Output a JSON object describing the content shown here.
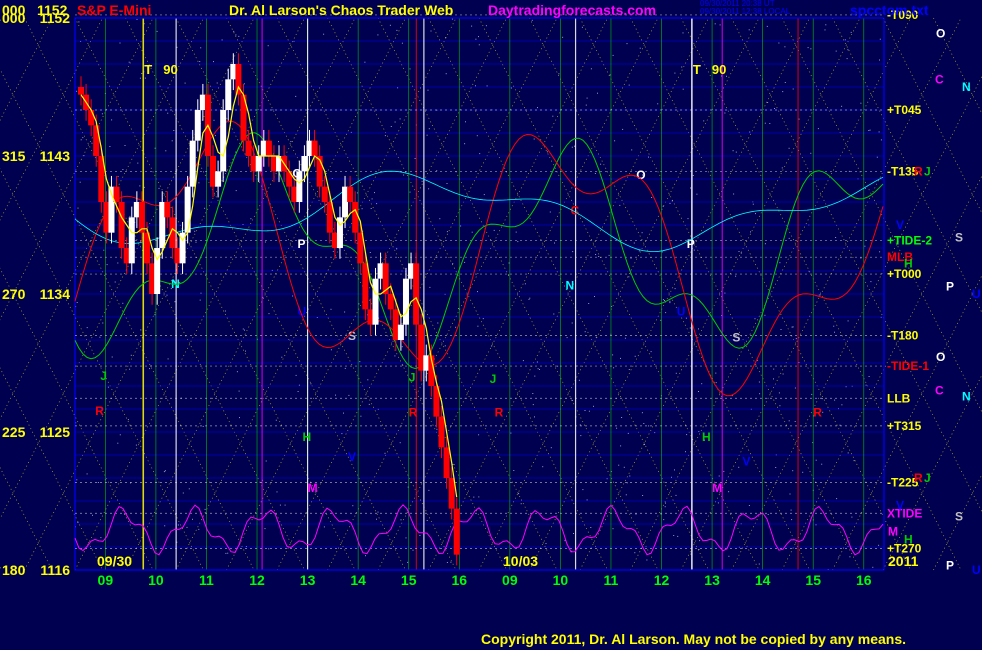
{
  "header": {
    "left_code": "000",
    "left_price": "1152",
    "symbol": "S&P E-Mini",
    "title": "Dr. Al Larson's Chaos Trader Web",
    "site": "Daytradingforecasts.com",
    "stamp_1": "09/30/2011 20:38 UT",
    "stamp_2": "09/30/2011 12:38 LOCAL",
    "file": "spcctom.txt"
  },
  "copyright": "Copyright 2011, Dr. Al Larson. May not be copied by any means.",
  "colors": {
    "background": "#000050",
    "grid": "#0000ff",
    "yellow_line": "#ffff00",
    "green_line": "#00cc00",
    "red_line": "#ff0000",
    "magenta_line": "#ff00ff",
    "cyan_line": "#00ffff",
    "up_bar": "#ffffff",
    "down_bar": "#ff0000"
  },
  "chart_data": {
    "type": "candlestick",
    "title": "S&P E-Mini",
    "y_range": [
      1116,
      1152
    ],
    "y_ticks": [
      {
        "code": "000",
        "price": "1152",
        "value": 1152
      },
      {
        "code": "315",
        "price": "1143",
        "value": 1143
      },
      {
        "code": "270",
        "price": "1134",
        "value": 1134
      },
      {
        "code": "225",
        "price": "1125",
        "value": 1125
      },
      {
        "code": "180",
        "price": "1116",
        "value": 1116
      }
    ],
    "x_ticks": [
      "09",
      "10",
      "11",
      "12",
      "13",
      "14",
      "15",
      "16",
      "09",
      "10",
      "11",
      "12",
      "13",
      "14",
      "15",
      "16"
    ],
    "date_labels": [
      "09/30",
      "10/03"
    ],
    "year_label": "2011",
    "time_markers": [
      {
        "label": "T",
        "value": "90"
      },
      {
        "label": "T",
        "value": "90"
      }
    ],
    "price_closes": [
      1147,
      1146,
      1145,
      1143,
      1140,
      1138,
      1141,
      1140,
      1137,
      1136,
      1139,
      1140,
      1138,
      1136,
      1134,
      1137,
      1140,
      1139,
      1137,
      1136,
      1138,
      1141,
      1144,
      1146,
      1147,
      1143,
      1141,
      1142,
      1146,
      1148,
      1149,
      1147,
      1144,
      1143,
      1142,
      1143,
      1144,
      1143,
      1142,
      1143,
      1142,
      1141,
      1140,
      1142,
      1143,
      1144,
      1143,
      1141,
      1140,
      1138,
      1137,
      1139,
      1141,
      1140,
      1138,
      1136,
      1133,
      1132,
      1135,
      1136,
      1134,
      1133,
      1131,
      1132,
      1135,
      1136,
      1132,
      1129,
      1130,
      1128,
      1126,
      1124,
      1122,
      1120,
      1117
    ],
    "levels": [
      {
        "label": "-T090",
        "price": 1152.2
      },
      {
        "label": "+T045",
        "price": 1146.0
      },
      {
        "label": "-T135",
        "price": 1142.0
      },
      {
        "label": "+TIDE-2",
        "price": 1137.5
      },
      {
        "label": "MLB",
        "price": 1136.4
      },
      {
        "label": "+T000",
        "price": 1135.3
      },
      {
        "label": "-T180",
        "price": 1131.3
      },
      {
        "label": "-TIDE-1",
        "price": 1129.3
      },
      {
        "label": "LLB",
        "price": 1127.2
      },
      {
        "label": "+T315",
        "price": 1125.4
      },
      {
        "label": "-T225",
        "price": 1121.7
      },
      {
        "label": "XTIDE",
        "price": 1119.7
      },
      {
        "label": "+T270",
        "price": 1117.4
      }
    ],
    "side_glyphs": [
      {
        "text": "O",
        "color": "#ffffff",
        "price": 1151
      },
      {
        "text": "C",
        "color": "#ff00ff",
        "price": 1148
      },
      {
        "text": "N",
        "color": "#00ffff",
        "price": 1147.5
      },
      {
        "text": "R",
        "color": "#ff0000",
        "price": 1142
      },
      {
        "text": "J",
        "color": "#00cc00",
        "price": 1142
      },
      {
        "text": "V",
        "color": "#0000ff",
        "price": 1138.5
      },
      {
        "text": "S",
        "color": "#c0c0c0",
        "price": 1137.7
      },
      {
        "text": "H",
        "color": "#00cc00",
        "price": 1136
      },
      {
        "text": "P",
        "color": "#ffffff",
        "price": 1134.5
      },
      {
        "text": "U",
        "color": "#0000ff",
        "price": 1134
      },
      {
        "text": "O",
        "color": "#ffffff",
        "price": 1129.9
      },
      {
        "text": "C",
        "color": "#ff00ff",
        "price": 1127.7
      },
      {
        "text": "N",
        "color": "#00ffff",
        "price": 1127.3
      },
      {
        "text": "R",
        "color": "#ff0000",
        "price": 1122.0
      },
      {
        "text": "J",
        "color": "#00cc00",
        "price": 1122.0
      },
      {
        "text": "V",
        "color": "#0000ff",
        "price": 1120.2
      },
      {
        "text": "S",
        "color": "#c0c0c0",
        "price": 1119.5
      },
      {
        "text": "M",
        "color": "#ff00ff",
        "price": 1118.5
      },
      {
        "text": "H",
        "color": "#00cc00",
        "price": 1118.0
      },
      {
        "text": "P",
        "color": "#ffffff",
        "price": 1116.3
      },
      {
        "text": "U",
        "color": "#0000ff",
        "price": 1116.0
      }
    ],
    "plot_glyphs": [
      {
        "text": "O",
        "color": "#ffffff",
        "day": 1,
        "hour": 12.7,
        "price": 1141.6
      },
      {
        "text": "N",
        "color": "#00ffff",
        "day": 1,
        "hour": 10.3,
        "price": 1134.4
      },
      {
        "text": "P",
        "color": "#ffffff",
        "day": 1,
        "hour": 12.8,
        "price": 1137.0
      },
      {
        "text": "U",
        "color": "#0000ff",
        "day": 1,
        "hour": 12.8,
        "price": 1132.6
      },
      {
        "text": "S",
        "color": "#c0c0c0",
        "day": 1,
        "hour": 13.8,
        "price": 1131.0
      },
      {
        "text": "J",
        "color": "#00cc00",
        "day": 1,
        "hour": 8.9,
        "price": 1128.4
      },
      {
        "text": "R",
        "color": "#ff0000",
        "day": 1,
        "hour": 8.8,
        "price": 1126.1
      },
      {
        "text": "H",
        "color": "#00cc00",
        "day": 1,
        "hour": 12.9,
        "price": 1124.4
      },
      {
        "text": "V",
        "color": "#0000ff",
        "day": 1,
        "hour": 13.8,
        "price": 1123.1
      },
      {
        "text": "M",
        "color": "#ff00ff",
        "day": 1,
        "hour": 13.0,
        "price": 1121.1
      },
      {
        "text": "R",
        "color": "#ff0000",
        "day": 1,
        "hour": 15.0,
        "price": 1126.0
      },
      {
        "text": "J",
        "color": "#00cc00",
        "day": 1,
        "hour": 15.0,
        "price": 1128.3
      },
      {
        "text": "R",
        "color": "#ff0000",
        "day": 2,
        "hour": 8.7,
        "price": 1126.0
      },
      {
        "text": "J",
        "color": "#00cc00",
        "day": 2,
        "hour": 8.6,
        "price": 1128.2
      },
      {
        "text": "N",
        "color": "#00ffff",
        "day": 2,
        "hour": 10.1,
        "price": 1134.3
      },
      {
        "text": "C",
        "color": "#ff0000",
        "day": 2,
        "hour": 10.2,
        "price": 1139.2
      },
      {
        "text": "O",
        "color": "#ffffff",
        "day": 2,
        "hour": 11.5,
        "price": 1141.5
      },
      {
        "text": "P",
        "color": "#ffffff",
        "day": 2,
        "hour": 12.5,
        "price": 1137.0
      },
      {
        "text": "U",
        "color": "#0000ff",
        "day": 2,
        "hour": 12.3,
        "price": 1132.6
      },
      {
        "text": "S",
        "color": "#c0c0c0",
        "day": 2,
        "hour": 13.4,
        "price": 1130.9
      },
      {
        "text": "H",
        "color": "#00cc00",
        "day": 2,
        "hour": 12.8,
        "price": 1124.4
      },
      {
        "text": "V",
        "color": "#0000ff",
        "day": 2,
        "hour": 13.6,
        "price": 1122.8
      },
      {
        "text": "M",
        "color": "#ff00ff",
        "day": 2,
        "hour": 13.0,
        "price": 1121.1
      },
      {
        "text": "R",
        "color": "#ff0000",
        "day": 2,
        "hour": 15.0,
        "price": 1126.0
      }
    ]
  }
}
